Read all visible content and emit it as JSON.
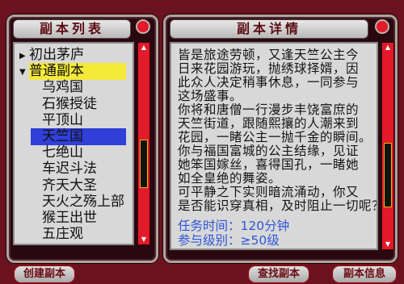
{
  "left_panel": {
    "title": "副本列表",
    "items": [
      {
        "label": "初出茅庐",
        "type": "category",
        "expanded": false
      },
      {
        "label": "普通副本",
        "type": "category",
        "expanded": true,
        "highlight": "yellow"
      },
      {
        "label": "乌鸡国",
        "type": "dungeon"
      },
      {
        "label": "石猴授徒",
        "type": "dungeon"
      },
      {
        "label": "平顶山",
        "type": "dungeon"
      },
      {
        "label": "天竺国",
        "type": "dungeon",
        "selected": true
      },
      {
        "label": "七绝山",
        "type": "dungeon"
      },
      {
        "label": "车迟斗法",
        "type": "dungeon"
      },
      {
        "label": "齐天大圣",
        "type": "dungeon"
      },
      {
        "label": "天火之殇上部",
        "type": "dungeon"
      },
      {
        "label": "猴王出世",
        "type": "dungeon"
      },
      {
        "label": "五庄观",
        "type": "dungeon"
      }
    ]
  },
  "right_panel": {
    "title": "副本详情",
    "description": "皆是旅途劳顿，又逢天竺公主今\n日来花园游玩，抛绣球择婿，因\n此众人决定稍事休息，一同参与\n这场盛事。\n你将和唐僧一行漫步丰饶富庶的\n天竺街道，跟随熙攘的人潮来到\n花园，一睹公主一抛千金的瞬间。\n你与福国富城的公主结缘，见证\n她笨国嫁丝，喜得国孔，一睹她\n如全皇绝的舞姿。\n可平静之下实则暗流涌动，你又\n是否能识穿真相，及时阻止一切呢？",
    "time_text": "任务时间：120分钟",
    "level_text": "参与级别：≥50级"
  },
  "buttons": {
    "create": "创建副本",
    "find": "查找副本",
    "info": "副本信息"
  },
  "colors": {
    "background": "#6b1220",
    "highlight_yellow": "#f5e93a",
    "selected_blue": "#2f3fd8",
    "info_blue": "#2e56d8"
  }
}
